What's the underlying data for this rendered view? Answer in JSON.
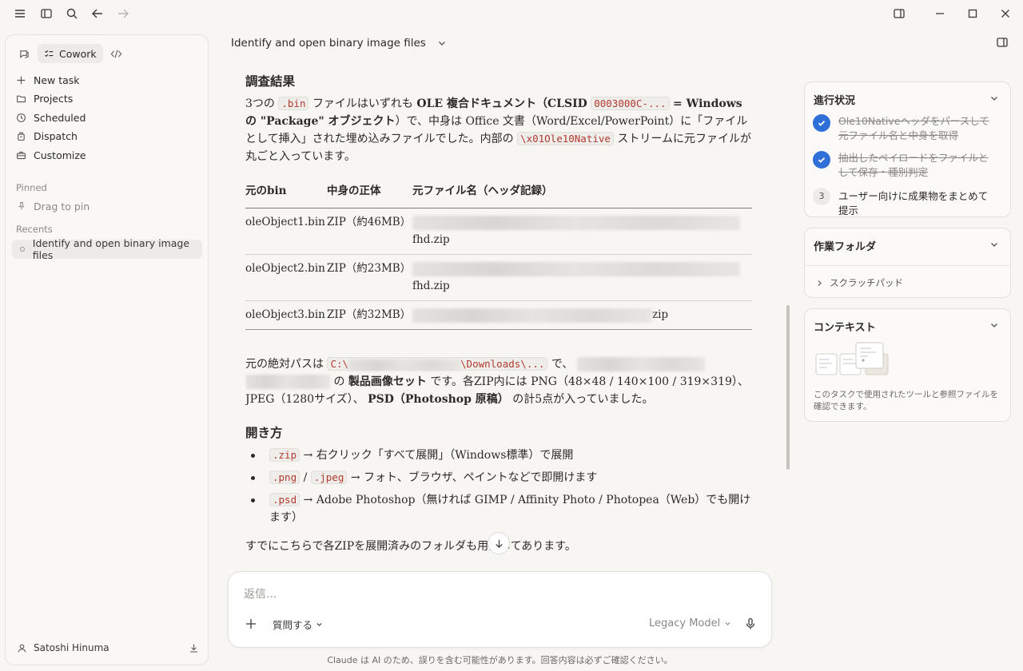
{
  "window": {
    "icons": [
      "menu-icon",
      "sidebar-toggle-icon",
      "search-icon",
      "back-icon",
      "forward-icon",
      "side-panel-icon",
      "minimize-icon",
      "maximize-icon",
      "close-icon"
    ]
  },
  "sidebar": {
    "mode_label": "Cowork",
    "nav": [
      {
        "label": "New task",
        "icon": "plus-icon"
      },
      {
        "label": "Projects",
        "icon": "folder-icon"
      },
      {
        "label": "Scheduled",
        "icon": "clock-icon"
      },
      {
        "label": "Dispatch",
        "icon": "dispatch-icon"
      },
      {
        "label": "Customize",
        "icon": "briefcase-icon"
      }
    ],
    "pinned_label": "Pinned",
    "pin_hint": "Drag to pin",
    "recents_label": "Recents",
    "recent_item": "Identify and open binary image files",
    "user_name": "Satoshi Hinuma"
  },
  "header": {
    "title": "Identify and open binary image files"
  },
  "content": {
    "heading1": "調査結果",
    "p1": {
      "t1": "3つの",
      "c1": ".bin",
      "t2": "ファイルはいずれも",
      "b1": "OLE 複合ドキュメント（CLSID",
      "c2": "0003000C-...",
      "b2": "= Windows の \"Package\" オブジェクト",
      "t3": "）で、中身は Office 文書（Word/Excel/PowerPoint）に「ファイルとして挿入」された埋め込みファイルでした。内部の",
      "c3": "\\x01Ole10Native",
      "t4": "ストリームに元ファイルが丸ごと入っています。"
    },
    "table": {
      "headers": [
        "元のbin",
        "中身の正体",
        "元ファイル名（ヘッダ記録）"
      ],
      "rows": [
        {
          "bin": "oleObject1.bin",
          "kind": "ZIP（約46MB）",
          "name_tail": "fhd.zip"
        },
        {
          "bin": "oleObject2.bin",
          "kind": "ZIP（約23MB）",
          "name_tail": "fhd.zip"
        },
        {
          "bin": "oleObject3.bin",
          "kind": "ZIP（約32MB）",
          "name_tail": "zip"
        }
      ]
    },
    "p2": {
      "t1": "元の絶対パスは",
      "c1a": "C:\\",
      "c1b": "\\Downloads\\...",
      "t2": "で、",
      "t3": "の",
      "b1": "製品画像セット",
      "t4": "です。各ZIP内には PNG（48×48 / 140×100 / 319×319）、JPEG（1280サイズ）、",
      "b2": "PSD（Photoshop 原稿）",
      "t5": "の計5点が入っていました。"
    },
    "heading2": "開き方",
    "howto": [
      {
        "code": ".zip",
        "text": "→ 右クリック「すべて展開」（Windows標準）で展開"
      },
      {
        "code": ".png",
        "sep": "/",
        "code2": ".jpeg",
        "text": "→ フォト、ブラウザ、ペイントなどで即開けます"
      },
      {
        "code": ".psd",
        "text": "→ Adobe Photoshop（無ければ GIMP / Affinity Photo / Photopea（Web）でも開けます）"
      }
    ],
    "p3": "すでにこちらで各ZIPを展開済みのフォルダも用意してあります。"
  },
  "composer": {
    "placeholder": "返信...",
    "ask_label": "質問する",
    "model_label": "Legacy Model",
    "disclaimer": "Claude は AI のため、誤りを含む可能性があります。回答内容は必ずご確認ください。"
  },
  "progress": {
    "title": "進行状況",
    "tasks": [
      {
        "text": "Ole10Nativeヘッダをパースして元ファイル名と中身を取得",
        "done": true
      },
      {
        "text": "抽出したペイロードをファイルとして保存・種別判定",
        "done": true
      },
      {
        "number": "3",
        "text": "ユーザー向けに成果物をまとめて提示",
        "done": false
      }
    ]
  },
  "folder": {
    "title": "作業フォルダ",
    "item": "スクラッチパッド"
  },
  "context": {
    "title": "コンテキスト",
    "description": "このタスクで使用されたツールと参照ファイルを確認できます。"
  },
  "colors": {
    "accent": "#2f6fd8",
    "code_text": "#b23a2f",
    "background": "#f7f6f3"
  }
}
